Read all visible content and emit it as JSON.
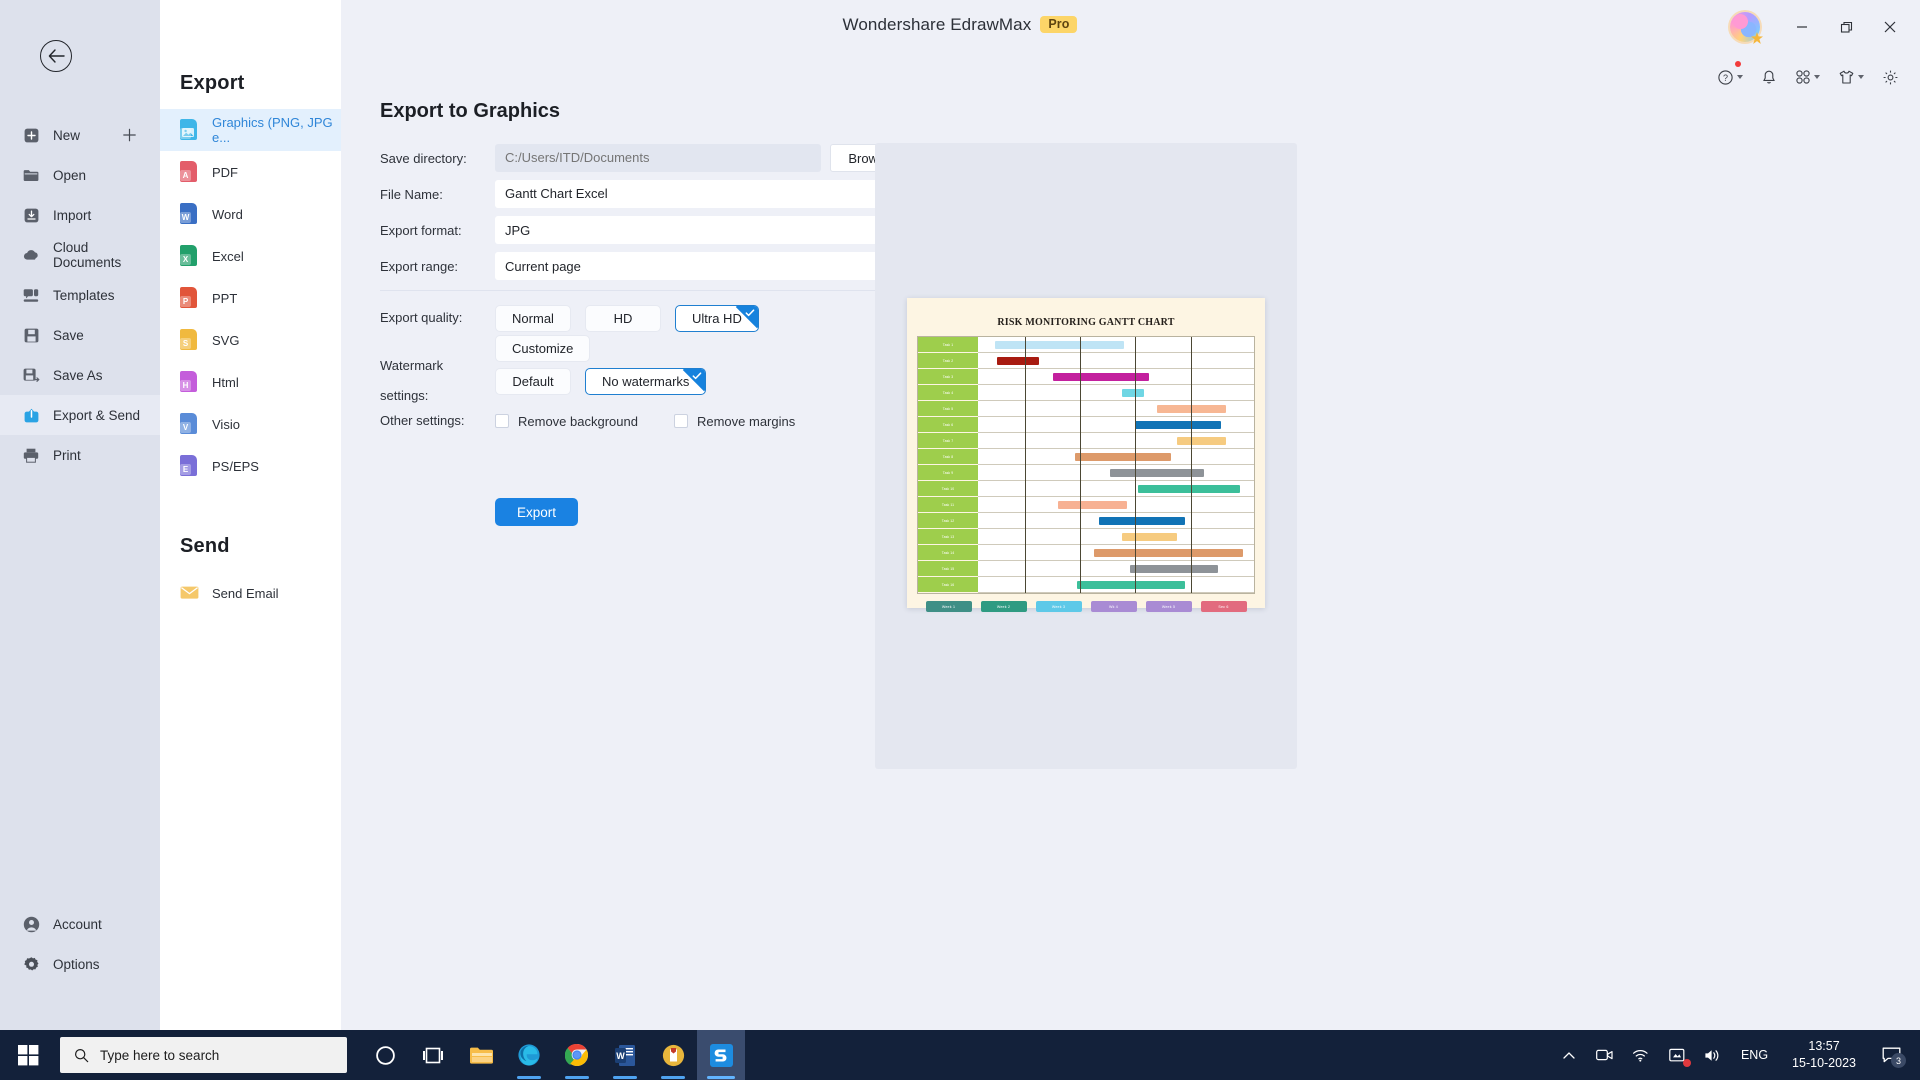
{
  "window": {
    "app_title": "Wondershare EdrawMax",
    "pro_badge": "Pro",
    "minimize": "Minimize",
    "maximize": "Restore",
    "close": "Close"
  },
  "toolbar": {
    "items": [
      {
        "name": "help-icon",
        "label": "Help"
      },
      {
        "name": "notification-bell-icon",
        "label": "Notifications"
      },
      {
        "name": "apps-grid-icon",
        "label": "Apps"
      },
      {
        "name": "theme-shirt-icon",
        "label": "Theme"
      },
      {
        "name": "gear-icon",
        "label": "Settings"
      }
    ]
  },
  "leftnav": {
    "back_label": "Back",
    "items": [
      {
        "label": "New",
        "icon": "new-icon",
        "trailing": "plus-icon"
      },
      {
        "label": "Open",
        "icon": "folder-icon"
      },
      {
        "label": "Import",
        "icon": "import-icon"
      },
      {
        "label": "Cloud Documents",
        "icon": "cloud-icon"
      },
      {
        "label": "Templates",
        "icon": "templates-icon"
      },
      {
        "label": "Save",
        "icon": "save-icon"
      },
      {
        "label": "Save As",
        "icon": "save-as-icon"
      },
      {
        "label": "Export & Send",
        "icon": "export-send-icon",
        "active": true
      },
      {
        "label": "Print",
        "icon": "print-icon"
      }
    ],
    "bottom_items": [
      {
        "label": "Account",
        "icon": "account-icon"
      },
      {
        "label": "Options",
        "icon": "options-gear-icon"
      }
    ]
  },
  "export_panel": {
    "heading": "Export",
    "formats": [
      {
        "label": "Graphics (PNG, JPG e...",
        "icon": "image-file-icon",
        "color": "#3fb6e8",
        "letter": "",
        "active": true
      },
      {
        "label": "PDF",
        "icon": "pdf-file-icon",
        "color": "#e35d6a",
        "letter": "A"
      },
      {
        "label": "Word",
        "icon": "word-file-icon",
        "color": "#3a6fc4",
        "letter": "W"
      },
      {
        "label": "Excel",
        "icon": "excel-file-icon",
        "color": "#22a06b",
        "letter": "X"
      },
      {
        "label": "PPT",
        "icon": "ppt-file-icon",
        "color": "#e1553a",
        "letter": "P"
      },
      {
        "label": "SVG",
        "icon": "svg-file-icon",
        "color": "#f0b93f",
        "letter": "S"
      },
      {
        "label": "Html",
        "icon": "html-file-icon",
        "color": "#c45ddb",
        "letter": "H"
      },
      {
        "label": "Visio",
        "icon": "visio-file-icon",
        "color": "#5a8cd8",
        "letter": "V"
      },
      {
        "label": "PS/EPS",
        "icon": "ps-eps-file-icon",
        "color": "#7a6fd8",
        "letter": "E"
      }
    ],
    "send_heading": "Send",
    "send_items": [
      {
        "label": "Send Email",
        "icon": "email-icon",
        "color": "#f5c86a"
      }
    ]
  },
  "main": {
    "title": "Export to Graphics",
    "fields": {
      "save_directory_label": "Save directory:",
      "save_directory_placeholder": "C:/Users/ITD/Documents",
      "save_directory_value": "",
      "browse_label": "Browse",
      "file_name_label": "File Name:",
      "file_name_value": "Gantt Chart Excel",
      "export_format_label": "Export format:",
      "export_format_value": "JPG",
      "export_range_label": "Export range:",
      "export_range_value": "Current page"
    },
    "export_quality": {
      "label": "Export quality:",
      "options": [
        "Normal",
        "HD",
        "Ultra HD"
      ],
      "selected": "Ultra HD",
      "customize_label": "Customize"
    },
    "watermark": {
      "label": "Watermark settings:",
      "options": [
        "Default",
        "No watermarks"
      ],
      "selected": "No watermarks"
    },
    "other_settings": {
      "label": "Other settings:",
      "checkboxes": [
        {
          "label": "Remove background",
          "checked": false
        },
        {
          "label": "Remove margins",
          "checked": false
        }
      ]
    },
    "export_button": "Export"
  },
  "preview": {
    "chart_title": "RISK MONITORING GANTT CHART",
    "paper_color": "#fdf5e3",
    "row_header_color": "#9ece4c"
  },
  "chart_data": {
    "type": "bar",
    "title": "RISK MONITORING GANTT CHART",
    "xlabel": "",
    "ylabel": "",
    "grid": true,
    "legend_position": "bottom",
    "categories": [
      "Task 1",
      "Task 2",
      "Task 3",
      "Task 4",
      "Task 5",
      "Task 6",
      "Task 7",
      "Task 8",
      "Task 9",
      "Task 10",
      "Task 11",
      "Task 12",
      "Task 13",
      "Task 14",
      "Task 15",
      "Task 16"
    ],
    "bars": [
      {
        "row": 0,
        "start": 6,
        "end": 53,
        "color": "#bfe4f5"
      },
      {
        "row": 1,
        "start": 7,
        "end": 22,
        "color": "#a81b10"
      },
      {
        "row": 2,
        "start": 27,
        "end": 62,
        "color": "#c3209e"
      },
      {
        "row": 3,
        "start": 52,
        "end": 60,
        "color": "#6fd6e4"
      },
      {
        "row": 4,
        "start": 65,
        "end": 90,
        "color": "#f7b793"
      },
      {
        "row": 5,
        "start": 57,
        "end": 88,
        "color": "#1173b5"
      },
      {
        "row": 6,
        "start": 72,
        "end": 90,
        "color": "#f6cb80"
      },
      {
        "row": 7,
        "start": 35,
        "end": 70,
        "color": "#dd9a6a"
      },
      {
        "row": 8,
        "start": 48,
        "end": 82,
        "color": "#8e9398"
      },
      {
        "row": 9,
        "start": 58,
        "end": 95,
        "color": "#3cbf9a"
      },
      {
        "row": 10,
        "start": 29,
        "end": 54,
        "color": "#f7b193"
      },
      {
        "row": 11,
        "start": 44,
        "end": 75,
        "color": "#1173b5"
      },
      {
        "row": 12,
        "start": 52,
        "end": 72,
        "color": "#f6cb80"
      },
      {
        "row": 13,
        "start": 42,
        "end": 96,
        "color": "#dd9a6a"
      },
      {
        "row": 14,
        "start": 55,
        "end": 87,
        "color": "#8e9398"
      },
      {
        "row": 15,
        "start": 36,
        "end": 75,
        "color": "#3cbf9a"
      }
    ],
    "milestone_lines": [
      17,
      37,
      57,
      77
    ],
    "legend": [
      {
        "label": "Week 1",
        "color": "#3f8f86"
      },
      {
        "label": "Week 2",
        "color": "#2f9b82"
      },
      {
        "label": "Week 3",
        "color": "#5ec9e8"
      },
      {
        "label": "Wk 4",
        "color": "#a98bd4"
      },
      {
        "label": "Week 5",
        "color": "#a98bd4"
      },
      {
        "label": "Sec 6",
        "color": "#e26b7e"
      }
    ]
  },
  "taskbar": {
    "start_label": "Start",
    "search_placeholder": "Type here to search",
    "items": [
      {
        "name": "cortana-icon",
        "label": "Cortana"
      },
      {
        "name": "task-view-icon",
        "label": "Task View"
      },
      {
        "name": "file-explorer-icon",
        "label": "File Explorer"
      },
      {
        "name": "microsoft-edge-icon",
        "label": "Microsoft Edge"
      },
      {
        "name": "google-chrome-icon",
        "label": "Google Chrome"
      },
      {
        "name": "microsoft-word-icon",
        "label": "Microsoft Word"
      },
      {
        "name": "wps-office-icon",
        "label": "WPS Office"
      },
      {
        "name": "edrawmax-icon",
        "label": "Wondershare EdrawMax"
      }
    ],
    "tray": [
      {
        "name": "show-hidden-icons",
        "label": "Show hidden icons"
      },
      {
        "name": "camera-icon",
        "label": "Camera"
      },
      {
        "name": "wifi-icon",
        "label": "Network"
      },
      {
        "name": "onedrive-sync-icon",
        "label": "OneDrive"
      },
      {
        "name": "volume-icon",
        "label": "Volume"
      }
    ],
    "language": "ENG",
    "time": "13:57",
    "date": "15-10-2023",
    "notification_count": "3"
  }
}
